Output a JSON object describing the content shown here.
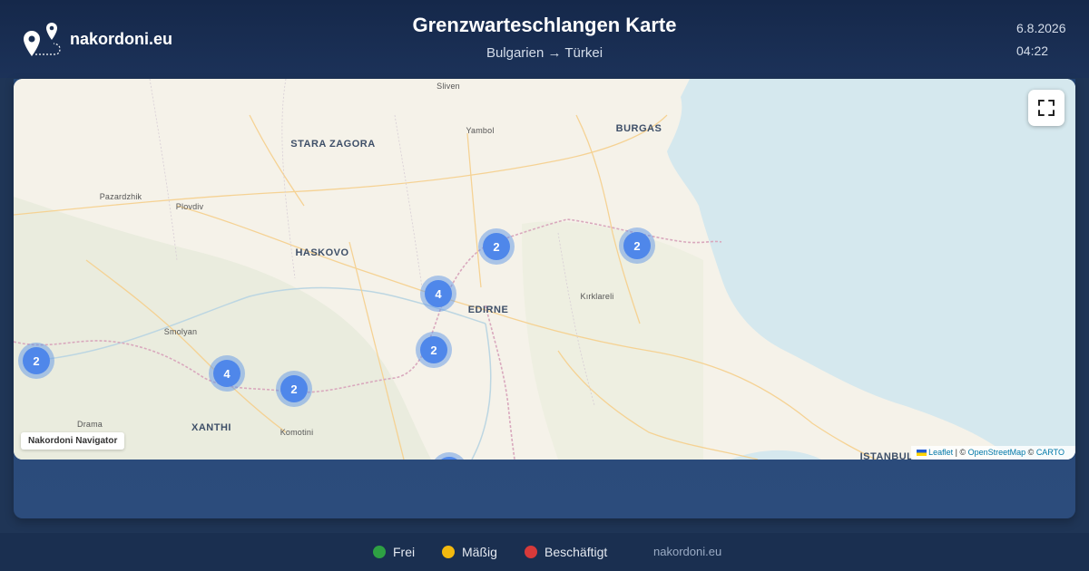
{
  "header": {
    "logo_text": "nakordoni.eu",
    "title": "Grenzwarteschlangen Karte",
    "subtitle": "Bulgarien → Türkei",
    "date": "6.8.2026",
    "time": "04:22"
  },
  "map": {
    "cities": [
      {
        "name": "Sliven",
        "major": false
      },
      {
        "name": "Yambol",
        "major": false
      },
      {
        "name": "STARA ZAGORA",
        "major": true
      },
      {
        "name": "BURGAS",
        "major": true
      },
      {
        "name": "Pazardzhik",
        "major": false
      },
      {
        "name": "Plovdiv",
        "major": false
      },
      {
        "name": "HASKOVO",
        "major": true
      },
      {
        "name": "EDIRNE",
        "major": true
      },
      {
        "name": "Kırklareli",
        "major": false
      },
      {
        "name": "Smolyan",
        "major": false
      },
      {
        "name": "Drama",
        "major": false
      },
      {
        "name": "XANTHI",
        "major": true
      },
      {
        "name": "Komotini",
        "major": false
      },
      {
        "name": "ISTANBUL",
        "major": true
      }
    ],
    "clusters": [
      {
        "count": "2"
      },
      {
        "count": "2"
      },
      {
        "count": "4"
      },
      {
        "count": "2"
      },
      {
        "count": "2"
      },
      {
        "count": "4"
      },
      {
        "count": "2"
      }
    ],
    "nav_label": "Nakordoni Navigator",
    "attribution": {
      "leaflet": "Leaflet",
      "sep1": " | © ",
      "osm": "OpenStreetMap",
      "sep2": " © ",
      "carto": "CARTO"
    },
    "fullscreen_icon": "fullscreen-icon"
  },
  "legend": [
    {
      "label": "Frei",
      "color": "#2ea043"
    },
    {
      "label": "Mäßig",
      "color": "#f2b90f"
    },
    {
      "label": "Beschäftigt",
      "color": "#d73a3a"
    }
  ],
  "footer": {
    "site": "nakordoni.eu"
  }
}
